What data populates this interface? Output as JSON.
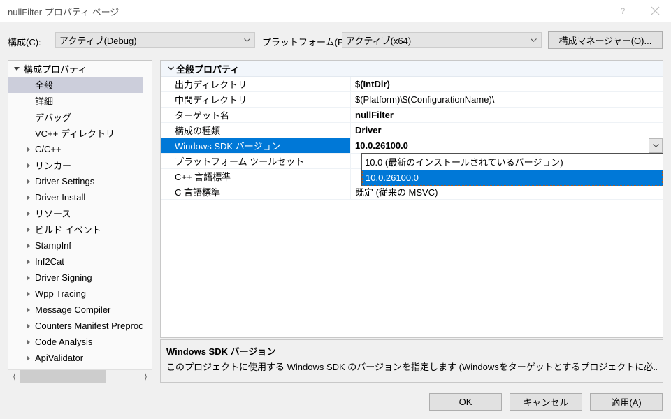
{
  "window": {
    "title": "nullFilter プロパティ ページ",
    "help_icon": "question-mark-icon",
    "close_icon": "close-icon"
  },
  "toolbar": {
    "configuration_label": "構成(C):",
    "configuration_value": "アクティブ(Debug)",
    "platform_label": "プラットフォーム(P):",
    "platform_value": "アクティブ(x64)",
    "config_manager_label": "構成マネージャー(O)..."
  },
  "tree": {
    "items": [
      {
        "label": "構成プロパティ",
        "level": 0,
        "arrow": "expanded",
        "selected": false
      },
      {
        "label": "全般",
        "level": 1,
        "arrow": "none",
        "selected": true
      },
      {
        "label": "詳細",
        "level": 1,
        "arrow": "none",
        "selected": false
      },
      {
        "label": "デバッグ",
        "level": 1,
        "arrow": "none",
        "selected": false
      },
      {
        "label": "VC++ ディレクトリ",
        "level": 1,
        "arrow": "none",
        "selected": false
      },
      {
        "label": "C/C++",
        "level": 1,
        "arrow": "collapsed",
        "selected": false
      },
      {
        "label": "リンカー",
        "level": 1,
        "arrow": "collapsed",
        "selected": false
      },
      {
        "label": "Driver Settings",
        "level": 1,
        "arrow": "collapsed",
        "selected": false
      },
      {
        "label": "Driver Install",
        "level": 1,
        "arrow": "collapsed",
        "selected": false
      },
      {
        "label": "リソース",
        "level": 1,
        "arrow": "collapsed",
        "selected": false
      },
      {
        "label": "ビルド イベント",
        "level": 1,
        "arrow": "collapsed",
        "selected": false
      },
      {
        "label": "StampInf",
        "level": 1,
        "arrow": "collapsed",
        "selected": false
      },
      {
        "label": "Inf2Cat",
        "level": 1,
        "arrow": "collapsed",
        "selected": false
      },
      {
        "label": "Driver Signing",
        "level": 1,
        "arrow": "collapsed",
        "selected": false
      },
      {
        "label": "Wpp Tracing",
        "level": 1,
        "arrow": "collapsed",
        "selected": false
      },
      {
        "label": "Message Compiler",
        "level": 1,
        "arrow": "collapsed",
        "selected": false
      },
      {
        "label": "Counters Manifest Preprocessor",
        "level": 1,
        "arrow": "collapsed",
        "selected": false
      },
      {
        "label": "Code Analysis",
        "level": 1,
        "arrow": "collapsed",
        "selected": false
      },
      {
        "label": "ApiValidator",
        "level": 1,
        "arrow": "collapsed",
        "selected": false
      }
    ],
    "scroll_left_icon": "chevron-left-icon",
    "scroll_right_icon": "chevron-right-icon"
  },
  "grid": {
    "section_header": "全般プロパティ",
    "rows": [
      {
        "name": "出力ディレクトリ",
        "value": "$(IntDir)",
        "bold": true,
        "selected": false
      },
      {
        "name": "中間ディレクトリ",
        "value": "$(Platform)\\$(ConfigurationName)\\",
        "bold": false,
        "selected": false
      },
      {
        "name": "ターゲット名",
        "value": "nullFilter",
        "bold": true,
        "selected": false
      },
      {
        "name": "構成の種類",
        "value": "Driver",
        "bold": true,
        "selected": false
      },
      {
        "name": "Windows SDK バージョン",
        "value": "10.0.26100.0",
        "bold": true,
        "selected": true
      },
      {
        "name": "プラットフォーム ツールセット",
        "value": "",
        "bold": false,
        "selected": false
      },
      {
        "name": "C++ 言語標準",
        "value": "",
        "bold": false,
        "selected": false
      },
      {
        "name": "C 言語標準",
        "value": "既定 (従来の MSVC)",
        "bold": false,
        "selected": false
      }
    ]
  },
  "dropdown": {
    "options": [
      {
        "label": "10.0 (最新のインストールされているバージョン)",
        "highlighted": false
      },
      {
        "label": "10.0.26100.0",
        "highlighted": true
      }
    ]
  },
  "description": {
    "title": "Windows SDK バージョン",
    "body": "このプロジェクトに使用する Windows SDK のバージョンを指定します (Windowsをターゲットとするプロジェクトに必..."
  },
  "footer": {
    "ok_label": "OK",
    "cancel_label": "キャンセル",
    "apply_label": "適用(A)"
  },
  "colors": {
    "accent_blue": "#0078d7",
    "tree_selection": "#cccedb",
    "header_bg": "#f2f6fb",
    "dialog_bg": "#f0f0f0"
  }
}
